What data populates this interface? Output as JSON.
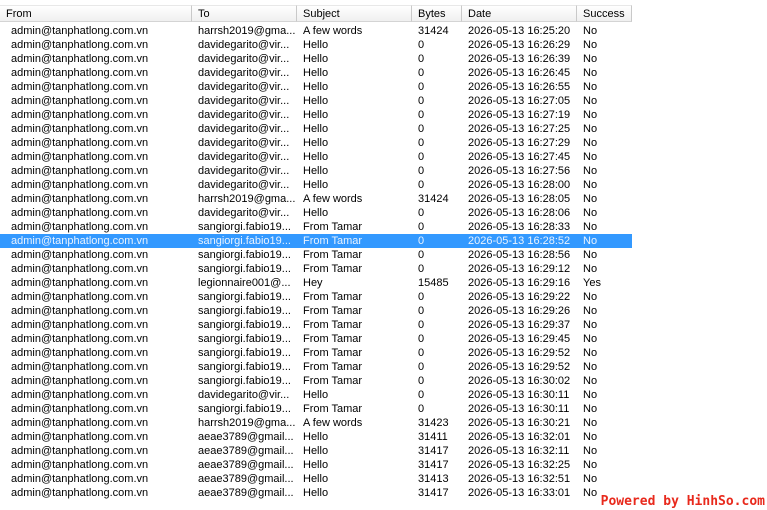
{
  "columns": {
    "from": "From",
    "to": "To",
    "subject": "Subject",
    "bytes": "Bytes",
    "date": "Date",
    "success": "Success"
  },
  "selected_row": 15,
  "rows": [
    {
      "from": "admin@tanphatlong.com.vn",
      "to": "harrsh2019@gma...",
      "subject": "A few words",
      "bytes": "31424",
      "date": "2026-05-13 16:25:20",
      "success": "No"
    },
    {
      "from": "admin@tanphatlong.com.vn",
      "to": "davidegarito@vir...",
      "subject": "Hello",
      "bytes": "0",
      "date": "2026-05-13 16:26:29",
      "success": "No"
    },
    {
      "from": "admin@tanphatlong.com.vn",
      "to": "davidegarito@vir...",
      "subject": "Hello",
      "bytes": "0",
      "date": "2026-05-13 16:26:39",
      "success": "No"
    },
    {
      "from": "admin@tanphatlong.com.vn",
      "to": "davidegarito@vir...",
      "subject": "Hello",
      "bytes": "0",
      "date": "2026-05-13 16:26:45",
      "success": "No"
    },
    {
      "from": "admin@tanphatlong.com.vn",
      "to": "davidegarito@vir...",
      "subject": "Hello",
      "bytes": "0",
      "date": "2026-05-13 16:26:55",
      "success": "No"
    },
    {
      "from": "admin@tanphatlong.com.vn",
      "to": "davidegarito@vir...",
      "subject": "Hello",
      "bytes": "0",
      "date": "2026-05-13 16:27:05",
      "success": "No"
    },
    {
      "from": "admin@tanphatlong.com.vn",
      "to": "davidegarito@vir...",
      "subject": "Hello",
      "bytes": "0",
      "date": "2026-05-13 16:27:19",
      "success": "No"
    },
    {
      "from": "admin@tanphatlong.com.vn",
      "to": "davidegarito@vir...",
      "subject": "Hello",
      "bytes": "0",
      "date": "2026-05-13 16:27:25",
      "success": "No"
    },
    {
      "from": "admin@tanphatlong.com.vn",
      "to": "davidegarito@vir...",
      "subject": "Hello",
      "bytes": "0",
      "date": "2026-05-13 16:27:29",
      "success": "No"
    },
    {
      "from": "admin@tanphatlong.com.vn",
      "to": "davidegarito@vir...",
      "subject": "Hello",
      "bytes": "0",
      "date": "2026-05-13 16:27:45",
      "success": "No"
    },
    {
      "from": "admin@tanphatlong.com.vn",
      "to": "davidegarito@vir...",
      "subject": "Hello",
      "bytes": "0",
      "date": "2026-05-13 16:27:56",
      "success": "No"
    },
    {
      "from": "admin@tanphatlong.com.vn",
      "to": "davidegarito@vir...",
      "subject": "Hello",
      "bytes": "0",
      "date": "2026-05-13 16:28:00",
      "success": "No"
    },
    {
      "from": "admin@tanphatlong.com.vn",
      "to": "harrsh2019@gma...",
      "subject": "A few words",
      "bytes": "31424",
      "date": "2026-05-13 16:28:05",
      "success": "No"
    },
    {
      "from": "admin@tanphatlong.com.vn",
      "to": "davidegarito@vir...",
      "subject": "Hello",
      "bytes": "0",
      "date": "2026-05-13 16:28:06",
      "success": "No"
    },
    {
      "from": "admin@tanphatlong.com.vn",
      "to": "sangiorgi.fabio19...",
      "subject": "From Tamar",
      "bytes": "0",
      "date": "2026-05-13 16:28:33",
      "success": "No"
    },
    {
      "from": "admin@tanphatlong.com.vn",
      "to": "sangiorgi.fabio19...",
      "subject": "From Tamar",
      "bytes": "0",
      "date": "2026-05-13 16:28:52",
      "success": "No"
    },
    {
      "from": "admin@tanphatlong.com.vn",
      "to": "sangiorgi.fabio19...",
      "subject": "From Tamar",
      "bytes": "0",
      "date": "2026-05-13 16:28:56",
      "success": "No"
    },
    {
      "from": "admin@tanphatlong.com.vn",
      "to": "sangiorgi.fabio19...",
      "subject": "From Tamar",
      "bytes": "0",
      "date": "2026-05-13 16:29:12",
      "success": "No"
    },
    {
      "from": "admin@tanphatlong.com.vn",
      "to": "legionnaire001@...",
      "subject": "Hey",
      "bytes": "15485",
      "date": "2026-05-13 16:29:16",
      "success": "Yes"
    },
    {
      "from": "admin@tanphatlong.com.vn",
      "to": "sangiorgi.fabio19...",
      "subject": "From Tamar",
      "bytes": "0",
      "date": "2026-05-13 16:29:22",
      "success": "No"
    },
    {
      "from": "admin@tanphatlong.com.vn",
      "to": "sangiorgi.fabio19...",
      "subject": "From Tamar",
      "bytes": "0",
      "date": "2026-05-13 16:29:26",
      "success": "No"
    },
    {
      "from": "admin@tanphatlong.com.vn",
      "to": "sangiorgi.fabio19...",
      "subject": "From Tamar",
      "bytes": "0",
      "date": "2026-05-13 16:29:37",
      "success": "No"
    },
    {
      "from": "admin@tanphatlong.com.vn",
      "to": "sangiorgi.fabio19...",
      "subject": "From Tamar",
      "bytes": "0",
      "date": "2026-05-13 16:29:45",
      "success": "No"
    },
    {
      "from": "admin@tanphatlong.com.vn",
      "to": "sangiorgi.fabio19...",
      "subject": "From Tamar",
      "bytes": "0",
      "date": "2026-05-13 16:29:52",
      "success": "No"
    },
    {
      "from": "admin@tanphatlong.com.vn",
      "to": "sangiorgi.fabio19...",
      "subject": "From Tamar",
      "bytes": "0",
      "date": "2026-05-13 16:29:52",
      "success": "No"
    },
    {
      "from": "admin@tanphatlong.com.vn",
      "to": "sangiorgi.fabio19...",
      "subject": "From Tamar",
      "bytes": "0",
      "date": "2026-05-13 16:30:02",
      "success": "No"
    },
    {
      "from": "admin@tanphatlong.com.vn",
      "to": "davidegarito@vir...",
      "subject": "Hello",
      "bytes": "0",
      "date": "2026-05-13 16:30:11",
      "success": "No"
    },
    {
      "from": "admin@tanphatlong.com.vn",
      "to": "sangiorgi.fabio19...",
      "subject": "From Tamar",
      "bytes": "0",
      "date": "2026-05-13 16:30:11",
      "success": "No"
    },
    {
      "from": "admin@tanphatlong.com.vn",
      "to": "harrsh2019@gma...",
      "subject": "A few words",
      "bytes": "31423",
      "date": "2026-05-13 16:30:21",
      "success": "No"
    },
    {
      "from": "admin@tanphatlong.com.vn",
      "to": "aeae3789@gmail...",
      "subject": "Hello",
      "bytes": "31411",
      "date": "2026-05-13 16:32:01",
      "success": "No"
    },
    {
      "from": "admin@tanphatlong.com.vn",
      "to": "aeae3789@gmail...",
      "subject": "Hello",
      "bytes": "31417",
      "date": "2026-05-13 16:32:11",
      "success": "No"
    },
    {
      "from": "admin@tanphatlong.com.vn",
      "to": "aeae3789@gmail...",
      "subject": "Hello",
      "bytes": "31417",
      "date": "2026-05-13 16:32:25",
      "success": "No"
    },
    {
      "from": "admin@tanphatlong.com.vn",
      "to": "aeae3789@gmail...",
      "subject": "Hello",
      "bytes": "31413",
      "date": "2026-05-13 16:32:51",
      "success": "No"
    },
    {
      "from": "admin@tanphatlong.com.vn",
      "to": "aeae3789@gmail...",
      "subject": "Hello",
      "bytes": "31417",
      "date": "2026-05-13 16:33:01",
      "success": "No"
    }
  ],
  "watermark": "Powered by HinhSo.com"
}
